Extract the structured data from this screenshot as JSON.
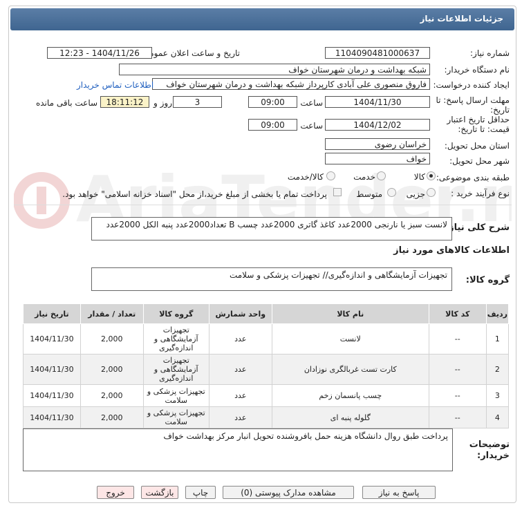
{
  "header": {
    "title": "جزئیات اطلاعات نیاز"
  },
  "form": {
    "need_number_label": "شماره نیاز:",
    "need_number": "1104090481000637",
    "announce_label": "تاریخ و ساعت اعلان عمومی:",
    "announce_value": "1404/11/26 - 12:23",
    "buyer_label": "نام دستگاه خریدار:",
    "buyer_value": "شبکه بهداشت و درمان شهرستان خواف",
    "creator_label": "ایجاد کننده درخواست:",
    "creator_value": "فاروق منصوری علی آبادی کارپرداز شبکه بهداشت و درمان شهرستان خواف",
    "contact_link": "اطلاعات تماس خریدار",
    "reply_label_1": "مهلت ارسال پاسخ: تا",
    "reply_label_2": "تاریخ:",
    "reply_date": "1404/11/30",
    "time_label": "ساعت",
    "reply_time": "09:00",
    "days_value": "3",
    "days_label": "روز و",
    "remaining_time": "18:11:12",
    "remaining_label": "ساعت باقی مانده",
    "validity_label_1": "حداقل تاریخ اعتبار",
    "validity_label_2": "قیمت: تا تاریخ:",
    "validity_date": "1404/12/02",
    "validity_time": "09:00",
    "province_label": "استان محل تحویل:",
    "province_value": "خراسان رضوی",
    "city_label": "شهر محل تحویل:",
    "city_value": "خواف",
    "category_label": "طبقه بندی موضوعی:",
    "category_options": [
      "کالا",
      "خدمت",
      "کالا/خدمت"
    ],
    "process_label": "نوع فرآیند خرید :",
    "process_options": [
      "جزیی",
      "متوسط"
    ],
    "payment_note": "پرداخت تمام یا بخشی از مبلغ خرید،از محل \"اسناد خزانه اسلامی\" خواهد بود."
  },
  "description": {
    "label": "شرح کلی نیاز:",
    "text": "لانست سبز یا نارنجی 2000عدد کاغذ گاتری 2000عدد چسب B تعداد2000عدد پنبه الکل 2000عدد"
  },
  "goods": {
    "section_title": "اطلاعات کالاهای مورد نیاز",
    "group_label": "گروه کالا:",
    "group_value": "تجهیزات آزمایشگاهی و اندازه‌گیری// تجهیزات پزشکی و سلامت"
  },
  "table": {
    "headers": [
      "ردیف",
      "کد کالا",
      "نام کالا",
      "واحد شمارش",
      "گروه کالا",
      "تعداد / مقدار",
      "تاریخ نیاز"
    ],
    "rows": [
      [
        "1",
        "--",
        "لانست",
        "عدد",
        "تجهیزات آزمایشگاهی و اندازه‌گیری",
        "2,000",
        "1404/11/30"
      ],
      [
        "2",
        "--",
        "کارت تست غربالگری نوزادان",
        "عدد",
        "تجهیزات آزمایشگاهی و اندازه‌گیری",
        "2,000",
        "1404/11/30"
      ],
      [
        "3",
        "--",
        "چسب پانسمان زخم",
        "عدد",
        "تجهیزات پزشکی و سلامت",
        "2,000",
        "1404/11/30"
      ],
      [
        "4",
        "--",
        "گلوله پنبه ای",
        "عدد",
        "تجهیزات پزشکی و سلامت",
        "2,000",
        "1404/11/30"
      ]
    ]
  },
  "notes": {
    "label_1": "توضیحات",
    "label_2": "خریدار:",
    "text": "پرداخت طبق روال دانشگاه هزینه حمل بافروشنده تحویل انبار مرکز بهداشت خواف"
  },
  "buttons": {
    "reply": "پاسخ به نیاز",
    "attachments": "مشاهده مدارک پیوستی (0)",
    "print": "چاپ",
    "back": "بازگشت",
    "exit": "خروج"
  },
  "watermark_text": "AriaTender.neT"
}
